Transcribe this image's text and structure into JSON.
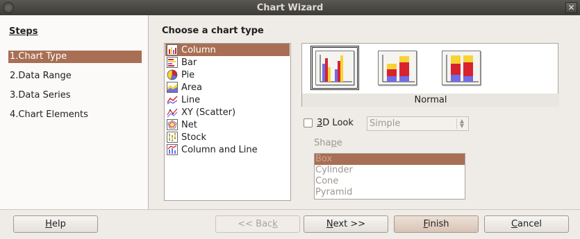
{
  "window": {
    "title": "Chart Wizard",
    "close_glyph": "✕"
  },
  "steps": {
    "heading": "Steps",
    "items": [
      {
        "label": "1.Chart Type"
      },
      {
        "label": "2.Data Range"
      },
      {
        "label": "3.Data Series"
      },
      {
        "label": "4.Chart Elements"
      }
    ],
    "selected": 0
  },
  "main": {
    "title": "Choose a chart type",
    "chart_types": [
      {
        "label": "Column",
        "icon": "column-chart-icon"
      },
      {
        "label": "Bar",
        "icon": "bar-chart-icon"
      },
      {
        "label": "Pie",
        "icon": "pie-chart-icon"
      },
      {
        "label": "Area",
        "icon": "area-chart-icon"
      },
      {
        "label": "Line",
        "icon": "line-chart-icon"
      },
      {
        "label": "XY (Scatter)",
        "icon": "scatter-chart-icon"
      },
      {
        "label": "Net",
        "icon": "net-chart-icon"
      },
      {
        "label": "Stock",
        "icon": "stock-chart-icon"
      },
      {
        "label": "Column and Line",
        "icon": "column-line-chart-icon"
      }
    ],
    "selected_type": 0,
    "variant_caption": "Normal",
    "variants": [
      "normal",
      "stacked",
      "percent-stacked"
    ],
    "three_d": {
      "label_u": "3",
      "label_rest": "D Look",
      "checked": false
    },
    "appearance_select": {
      "value": "Simple"
    },
    "shape": {
      "label_pre": "Sha",
      "label_u": "p",
      "label_post": "e",
      "items": [
        "Box",
        "Cylinder",
        "Cone",
        "Pyramid"
      ],
      "selected": 0
    }
  },
  "buttons": {
    "help": {
      "u": "H",
      "rest": "elp"
    },
    "back": {
      "pre": "<< Bac",
      "u": "k"
    },
    "next": {
      "u": "N",
      "rest": "ext >>"
    },
    "finish": {
      "u": "F",
      "rest": "inish"
    },
    "cancel": {
      "u": "C",
      "rest": "ancel"
    }
  },
  "colors": {
    "selection": "#a86f54",
    "bar_blue": "#6f6ee6",
    "bar_red": "#d8222e",
    "bar_yellow": "#f6d433"
  }
}
